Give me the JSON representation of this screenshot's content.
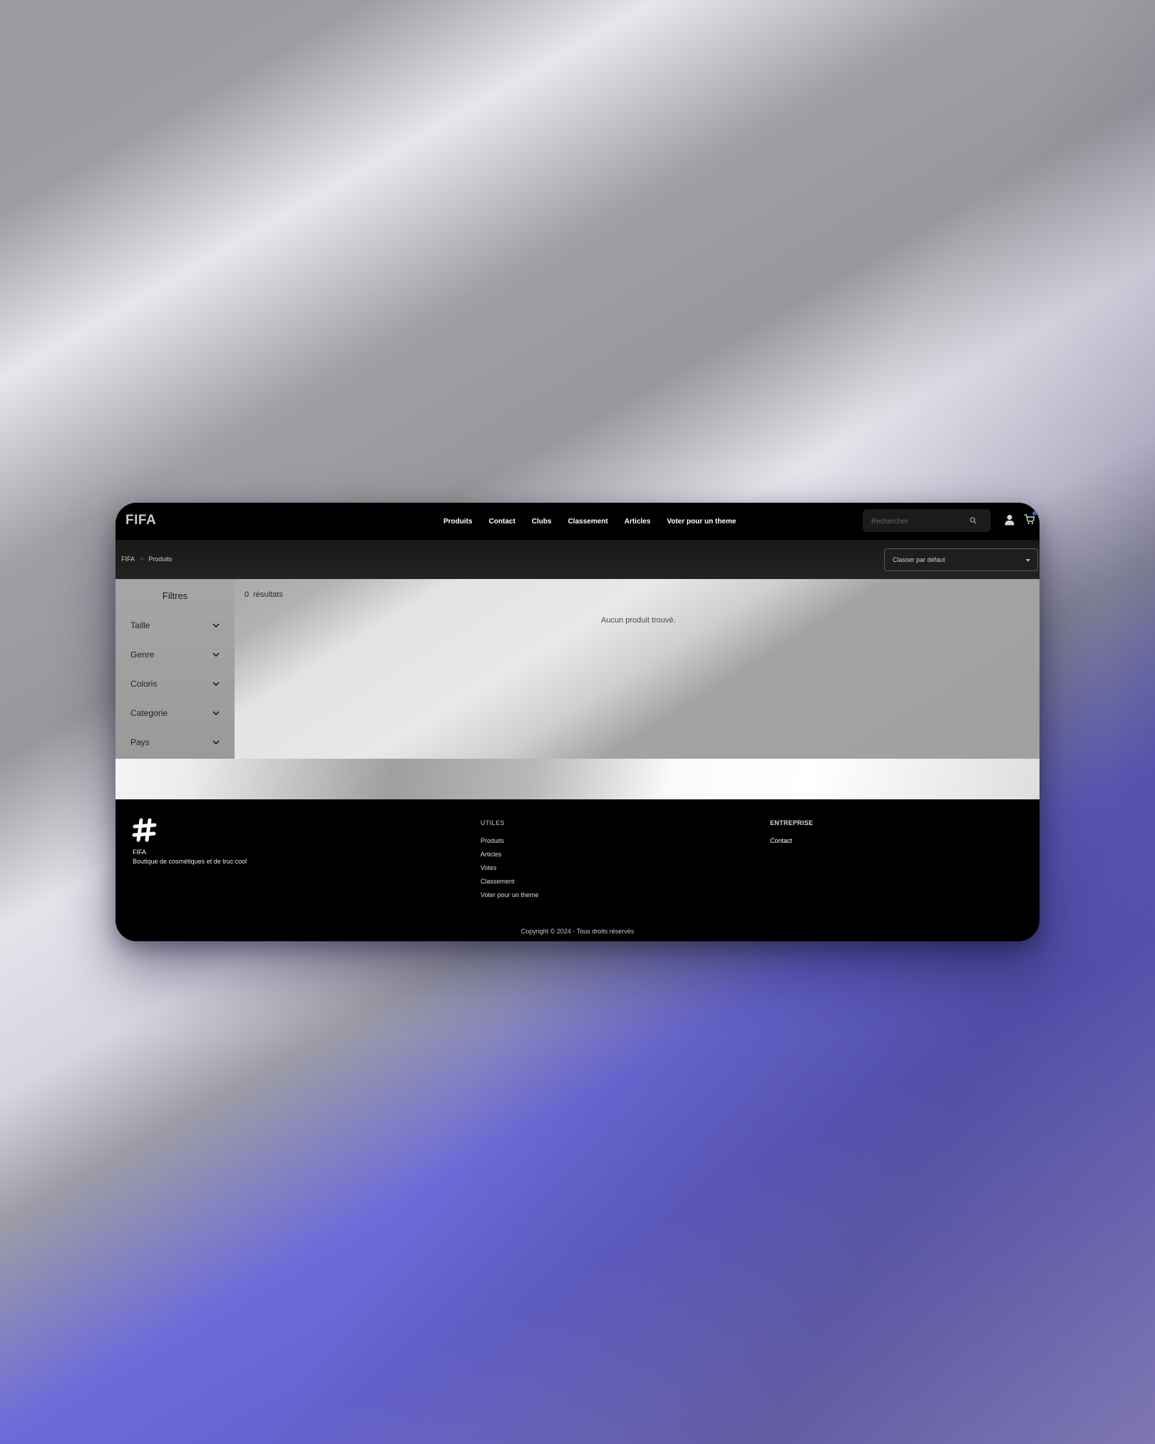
{
  "header": {
    "logo": "FIFA",
    "nav": [
      "Produits",
      "Contact",
      "Clubs",
      "Classement",
      "Articles",
      "Voter pour un theme"
    ],
    "search_placeholder": "Rechercher"
  },
  "breadcrumb": [
    "FIFA",
    "Produits"
  ],
  "sort": {
    "selected": "Classer par défaut"
  },
  "filters": {
    "title": "Filtres",
    "items": [
      "Taille",
      "Genre",
      "Coloris",
      "Categorie",
      "Pays"
    ]
  },
  "results": {
    "count": "0",
    "label": "résultats",
    "empty_message": "Aucun produit trouvé."
  },
  "footer": {
    "brand": "FIFA",
    "tagline": "Boutique de cosmétiques et de truc cool",
    "col1_title": "UTILES",
    "col1_links": [
      "Produits",
      "Articles",
      "Votes",
      "Classement",
      "Voter pour un theme"
    ],
    "col2_title": "ENTREPRISE",
    "col2_links": [
      "Contact"
    ],
    "copyright": "Copyright © 2024 - Tous droits réservés"
  },
  "colors": {
    "nav_bg": "#000000",
    "accent_dot": "#3b63c7",
    "background_purple": "#6663d0"
  }
}
